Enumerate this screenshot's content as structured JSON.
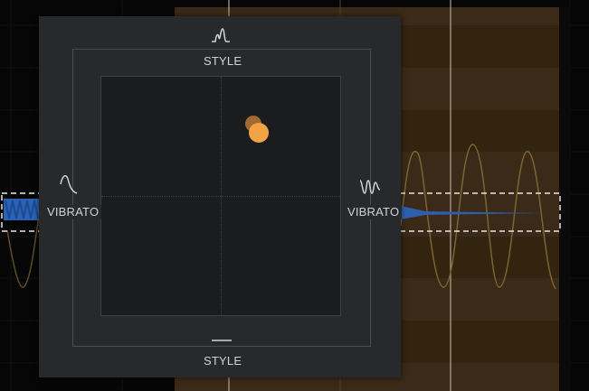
{
  "pad": {
    "top_label": "STYLE",
    "bottom_label": "STYLE",
    "left_label": "VIBRATO",
    "right_label": "VIBRATO"
  },
  "icons": {
    "top": "wavy-style-icon",
    "bottom": "flat-line-icon",
    "left": "smooth-curve-icon",
    "right": "vibrato-wave-icon"
  },
  "colors": {
    "accent": "#f2a444",
    "pad_background": "#27292c",
    "note_region": "#3a2a17",
    "note_bar": "#2a62b8"
  }
}
